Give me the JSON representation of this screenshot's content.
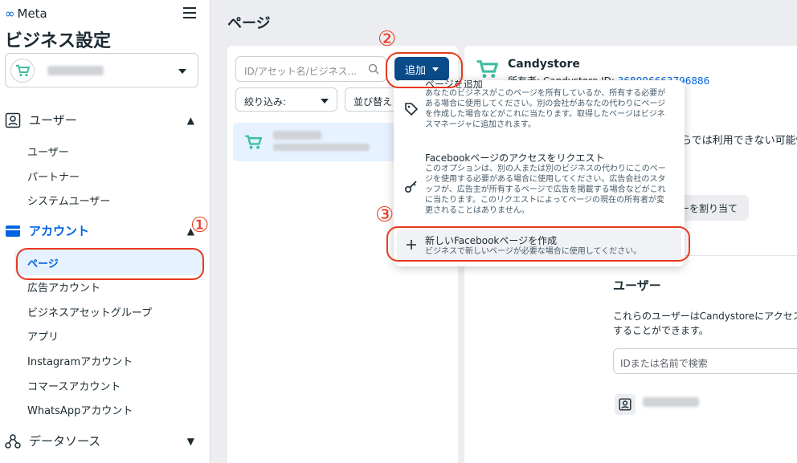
{
  "sidebar": {
    "logo_text": "Meta",
    "title": "ビジネス設定",
    "sections": {
      "users": {
        "label": "ユーザー",
        "items": [
          "ユーザー",
          "パートナー",
          "システムユーザー"
        ]
      },
      "accounts": {
        "label": "アカウント",
        "active_item": "ページ",
        "items": [
          "広告アカウント",
          "ビジネスアセットグループ",
          "アプリ",
          "Instagramアカウント",
          "コマースアカウント",
          "WhatsAppアカウント"
        ]
      },
      "data_sources": {
        "label": "データソース"
      }
    }
  },
  "main": {
    "title": "ページ",
    "search_placeholder": "ID/アセット名/ビジネス...",
    "add_label": "追加",
    "filter_label": "絞り込み:",
    "sort_label": "並び替え"
  },
  "detail": {
    "name": "Candystore",
    "owner_label": "所有者: Candystore",
    "id_label": "ID:",
    "id_value": "368006663796886",
    "partial_text": "らでは利用できない可能性",
    "assign_label": "ーを割り当て",
    "users_title": "ユーザー",
    "users_desc": "これらのユーザーはCandystoreにアクセスすることができます。",
    "user_search_placeholder": "IDまたは名前で検索"
  },
  "dropdown": {
    "items": [
      {
        "title": "ページを追加",
        "desc": "あなたのビジネスがこのページを所有しているか、所有する必要がある場合に使用してください。別の会社があなたの代わりにページを作成した場合などがこれに当たります。取得したページはビジネスマネージャに追加されます。"
      },
      {
        "title": "Facebookページのアクセスをリクエスト",
        "desc": "このオプションは、別の人または別のビジネスの代わりにこのページを使用する必要がある場合に使用してください。広告会社のスタッフが、広告主が所有するページで広告を掲載する場合などがこれに当たります。このリクエストによってページの現在の所有者が変更されることはありません。"
      },
      {
        "title": "新しいFacebookページを作成",
        "desc": "ビジネスで新しいページが必要な場合に使用してください。"
      }
    ]
  },
  "annotations": {
    "step1": "①",
    "step2": "②",
    "step3": "③"
  },
  "colors": {
    "accent": "#0064e0",
    "button": "#0a4c8a",
    "highlight": "#e8391f",
    "cart": "#3fbf9f"
  }
}
